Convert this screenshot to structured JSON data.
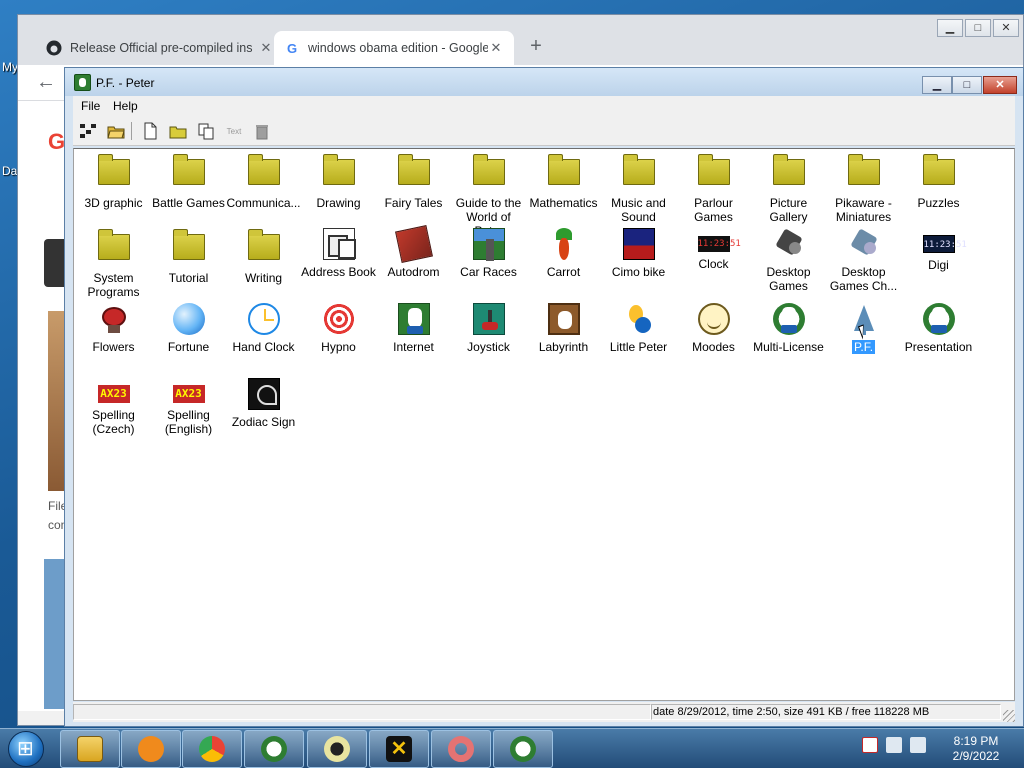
{
  "desktop": {
    "labels": [
      "My",
      "Da"
    ]
  },
  "chrome": {
    "tabs": [
      {
        "title": "Release Official pre-compiled ins",
        "favicon": "github-icon"
      },
      {
        "title": "windows obama edition - Google",
        "favicon": "google-icon"
      }
    ],
    "page_text": [
      "File",
      "con"
    ]
  },
  "window": {
    "title": "P.F. - Peter",
    "menu": [
      {
        "label": "File",
        "key": "F"
      },
      {
        "label": "Help",
        "key": "H"
      }
    ],
    "toolbar_text_button": "Text"
  },
  "items": [
    {
      "label": "3D graphic",
      "icon": "folder"
    },
    {
      "label": "Battle Games",
      "icon": "folder"
    },
    {
      "label": "Communica...",
      "icon": "folder"
    },
    {
      "label": "Drawing",
      "icon": "folder"
    },
    {
      "label": "Fairy Tales",
      "icon": "folder"
    },
    {
      "label": "Guide to the World of Pet...",
      "icon": "folder"
    },
    {
      "label": "Mathematics",
      "icon": "folder"
    },
    {
      "label": "Music and Sound",
      "icon": "folder"
    },
    {
      "label": "Parlour Games",
      "icon": "folder"
    },
    {
      "label": "Picture Gallery",
      "icon": "folder"
    },
    {
      "label": "Pikaware - Miniatures",
      "icon": "folder"
    },
    {
      "label": "Puzzles",
      "icon": "folder"
    },
    {
      "label": "System Programs",
      "icon": "folder"
    },
    {
      "label": "Tutorial",
      "icon": "folder"
    },
    {
      "label": "Writing",
      "icon": "folder"
    },
    {
      "label": "Address Book",
      "icon": "address-book"
    },
    {
      "label": "Autodrom",
      "icon": "autodrom"
    },
    {
      "label": "Car Races",
      "icon": "car-races"
    },
    {
      "label": "Carrot",
      "icon": "carrot"
    },
    {
      "label": "Cimo bike",
      "icon": "cimo-bike"
    },
    {
      "label": "Clock",
      "icon": "clock",
      "display": "11:23:51"
    },
    {
      "label": "Desktop Games",
      "icon": "desktop-games"
    },
    {
      "label": "Desktop Games Ch...",
      "icon": "desktop-games-ch"
    },
    {
      "label": "Digi",
      "icon": "digi",
      "display": "11:23:51"
    },
    {
      "label": "Flowers",
      "icon": "flowers"
    },
    {
      "label": "Fortune",
      "icon": "fortune"
    },
    {
      "label": "Hand Clock",
      "icon": "hand-clock"
    },
    {
      "label": "Hypno",
      "icon": "hypno"
    },
    {
      "label": "Internet",
      "icon": "internet"
    },
    {
      "label": "Joystick",
      "icon": "joystick"
    },
    {
      "label": "Labyrinth",
      "icon": "labyrinth"
    },
    {
      "label": "Little Peter",
      "icon": "little-peter"
    },
    {
      "label": "Moodes",
      "icon": "moodes"
    },
    {
      "label": "Multi-License",
      "icon": "multi-license"
    },
    {
      "label": "P.F.",
      "icon": "tree",
      "selected": true
    },
    {
      "label": "Presentation",
      "icon": "presentation"
    },
    {
      "label": "Spelling (Czech)",
      "icon": "spelling",
      "display": "AX23"
    },
    {
      "label": "Spelling (English)",
      "icon": "spelling",
      "display": "AX23"
    },
    {
      "label": "Zodiac Sign",
      "icon": "zodiac"
    }
  ],
  "status": {
    "info": "date 8/29/2012, time 2:50, size 491 KB / free 118228 MB"
  },
  "taskbar": {
    "time": "8:19 PM",
    "date": "2/9/2022",
    "apps": [
      "explorer",
      "media-player",
      "chrome",
      "rabbit-app",
      "alien-app",
      "x-app",
      "donut-app",
      "rabbit-app-2"
    ]
  },
  "colors": {
    "folder": "#c9bf2a",
    "selection": "#3399ff",
    "window_frame": "#d6e4f2",
    "taskbar": "#2f5f8f"
  }
}
